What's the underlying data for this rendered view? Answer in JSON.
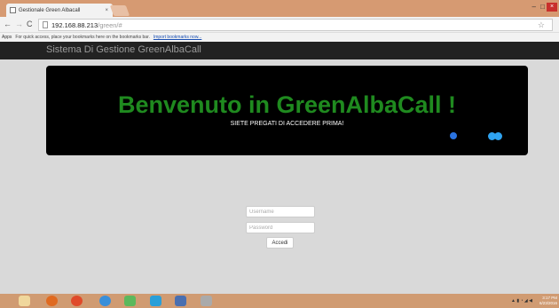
{
  "browser": {
    "tab_title": "Gestionale Green Albacall",
    "tab_close": "×",
    "window_min": "–",
    "window_max": "□",
    "window_close": "×",
    "url_host": "192.168.88.213",
    "url_path": "/green/#",
    "star": "☆",
    "bookmarks": {
      "apps_label": "Apps",
      "hint_text": "For quick access, place your bookmarks here on the bookmarks bar.",
      "import_link": "Import bookmarks now..."
    }
  },
  "app": {
    "brand": "Sistema Di Gestione GreenAlbaCall"
  },
  "hero": {
    "title": "Benvenuto in GreenAlbaCall !",
    "subtitle": "SIETE PREGATI DI ACCEDERE PRIMA!"
  },
  "login": {
    "username_placeholder": "Username",
    "username_value": "",
    "password_placeholder": "Password",
    "password_value": "",
    "submit_label": "Accedi"
  },
  "taskbar": {
    "icons": [
      "start-icon",
      "firefox-icon",
      "chrome-icon",
      "ie-icon",
      "app-icon",
      "skype-icon",
      "app-icon",
      "app-icon"
    ],
    "clock_time": "3:17 PM",
    "clock_date": "6/23/2016"
  }
}
